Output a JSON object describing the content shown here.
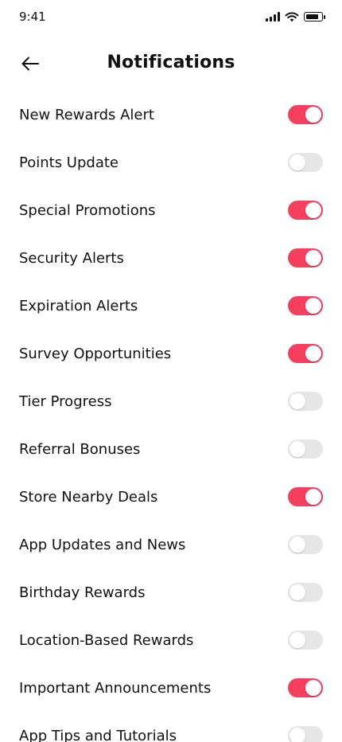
{
  "status_bar": {
    "time": "9:41",
    "battery_level": 0.85
  },
  "header": {
    "title": "Notifications",
    "back_icon": "arrow-left-icon"
  },
  "colors": {
    "accent": "#f43f5e",
    "toggle_off": "#e6e6e6"
  },
  "settings": [
    {
      "label": "New Rewards Alert",
      "enabled": true
    },
    {
      "label": "Points Update",
      "enabled": false
    },
    {
      "label": "Special Promotions",
      "enabled": true
    },
    {
      "label": "Security Alerts",
      "enabled": true
    },
    {
      "label": "Expiration Alerts",
      "enabled": true
    },
    {
      "label": "Survey Opportunities",
      "enabled": true
    },
    {
      "label": "Tier Progress",
      "enabled": false
    },
    {
      "label": "Referral Bonuses",
      "enabled": false
    },
    {
      "label": "Store Nearby Deals",
      "enabled": true
    },
    {
      "label": "App Updates and News",
      "enabled": false
    },
    {
      "label": "Birthday Rewards",
      "enabled": false
    },
    {
      "label": "Location-Based Rewards",
      "enabled": false
    },
    {
      "label": "Important Announcements",
      "enabled": true
    },
    {
      "label": "App Tips and Tutorials",
      "enabled": false
    }
  ]
}
